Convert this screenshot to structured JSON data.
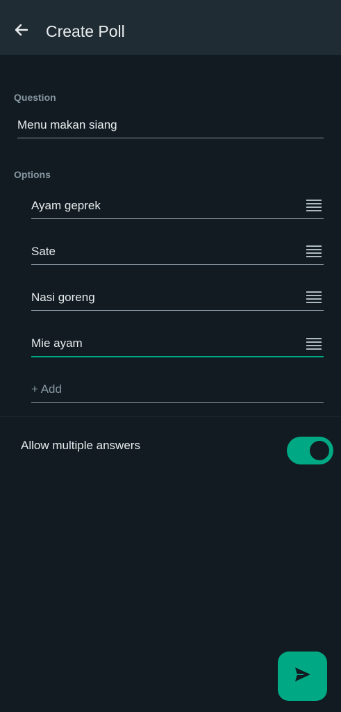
{
  "header": {
    "title": "Create Poll",
    "back_icon": "arrow-left-icon"
  },
  "question": {
    "label": "Question",
    "value": "Menu makan siang"
  },
  "options": {
    "label": "Options",
    "items": [
      {
        "value": "Ayam geprek"
      },
      {
        "value": "Sate"
      },
      {
        "value": "Nasi goreng"
      },
      {
        "value": "Mie ayam"
      }
    ],
    "add_placeholder": "+ Add",
    "drag_icon": "drag-handle-icon"
  },
  "settings": {
    "allow_multiple_label": "Allow multiple answers",
    "allow_multiple_enabled": true
  },
  "send": {
    "icon": "send-icon"
  },
  "colors": {
    "background": "#111b21",
    "header": "#202c33",
    "accent": "#00a884",
    "muted": "#8696a0",
    "text": "#e9edef"
  }
}
